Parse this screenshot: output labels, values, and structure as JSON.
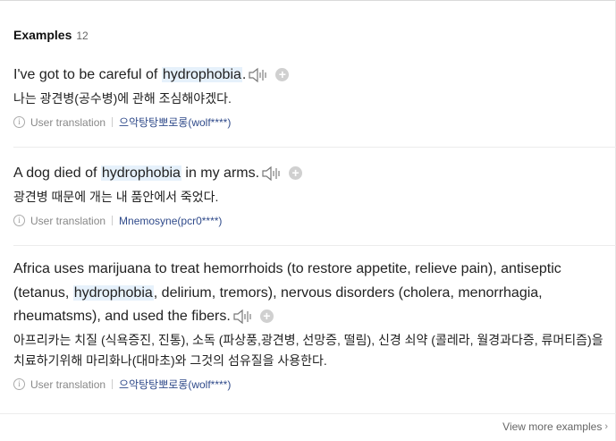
{
  "header": {
    "title": "Examples",
    "count": "12"
  },
  "examples": [
    {
      "before": "I've got to be careful of ",
      "keyword": "hydrophobia",
      "after": ".",
      "translation": "나는 광견병(공수병)에 관해 조심해야겠다.",
      "source_label": "User translation",
      "author": "으악탕탕뽀로롱(wolf****)"
    },
    {
      "before": "A dog died of ",
      "keyword": "hydrophobia",
      "after": " in my arms.",
      "translation": "광견병 때문에 개는 내 품안에서 죽었다.",
      "source_label": "User translation",
      "author": "Mnemosyne(pcr0****)"
    },
    {
      "before": "Africa uses marijuana to treat hemorrhoids (to restore appetite, relieve pain), antiseptic (tetanus, ",
      "keyword": "hydrophobia",
      "after": ", delirium, tremors), nervous disorders (cholera, menorrhagia, rheumatsms), and used the fibers.",
      "translation": "아프리카는 치질 (식욕증진, 진통), 소독 (파상풍,광견병, 선망증, 떨림), 신경 쇠약 (콜레라, 월경과다증, 류머티즘)을 치료하기위해 마리화나(대마초)와 그것의 섬유질을 사용한다.",
      "source_label": "User translation",
      "author": "으악탕탕뽀로롱(wolf****)"
    }
  ],
  "icons": {
    "speaker": "speaker-icon",
    "add": "plus-circle-icon",
    "info": "info-icon",
    "chevron": "chevron-right-icon"
  },
  "footer": {
    "more_label": "View more examples"
  },
  "colors": {
    "highlight": "#e6f1fb",
    "author": "#2f4a8a",
    "add_button": "#d0d0d0"
  }
}
